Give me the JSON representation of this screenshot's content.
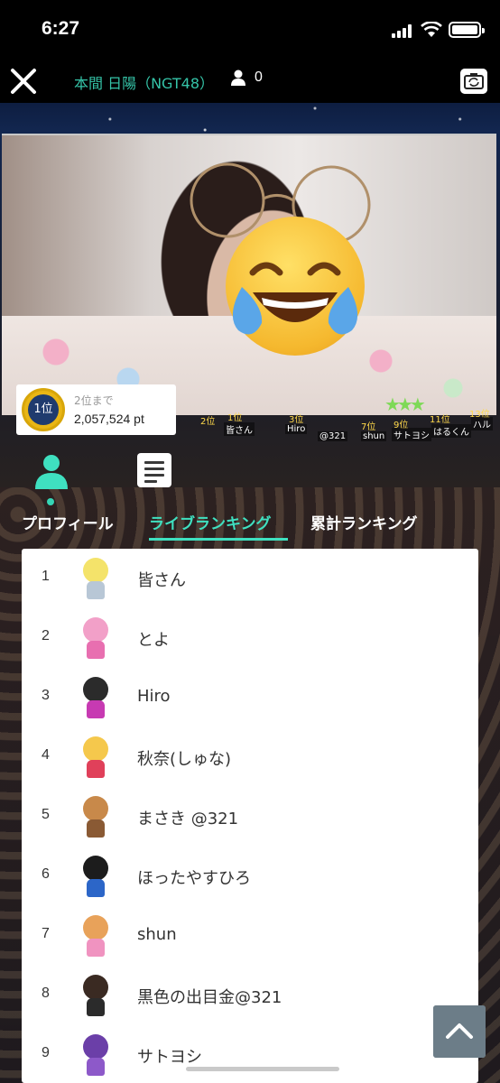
{
  "status_bar": {
    "time": "6:27",
    "icons": [
      "cellular-signal-icon",
      "wifi-icon",
      "battery-icon"
    ]
  },
  "header": {
    "close_icon": "close-icon",
    "title": "本間 日陽（NGT48）",
    "viewer_icon": "person-icon",
    "viewer_count": "0",
    "camera_icon": "camera-switch-icon"
  },
  "rank_badge": {
    "medal": "1位",
    "next_label": "2位まで",
    "points": "2,057,524 pt"
  },
  "crowd_strip": {
    "ranks": [
      "2位",
      "1位",
      "3位",
      "7位",
      "9位",
      "11位",
      "13位"
    ],
    "names": [
      "皆さん",
      "Hiro",
      "@321",
      "shun",
      "サトヨシ",
      "はるくん",
      "ハル"
    ]
  },
  "tabs": {
    "icons": [
      "profile-icon",
      "document-icon"
    ],
    "items": [
      {
        "label": "プロフィール",
        "active": false
      },
      {
        "label": "ライブランキング",
        "active": true
      },
      {
        "label": "累計ランキング",
        "active": false
      }
    ]
  },
  "ranking": {
    "rows": [
      {
        "rank": "1",
        "name": "皆さん"
      },
      {
        "rank": "2",
        "name": "とよ"
      },
      {
        "rank": "3",
        "name": "Hiro"
      },
      {
        "rank": "4",
        "name": "秋奈(しゅな)"
      },
      {
        "rank": "5",
        "name": "まさき @321"
      },
      {
        "rank": "6",
        "name": "ほったやすひろ"
      },
      {
        "rank": "7",
        "name": "shun"
      },
      {
        "rank": "8",
        "name": "黒色の出目金@321"
      },
      {
        "rank": "9",
        "name": "サトヨシ"
      }
    ]
  },
  "scroll_top_icon": "chevron-up-icon",
  "colors": {
    "accent": "#3fe0c0",
    "title": "#35c4a8",
    "medal_gold": "#e9b615",
    "scroll_button": "#6c7d88"
  }
}
